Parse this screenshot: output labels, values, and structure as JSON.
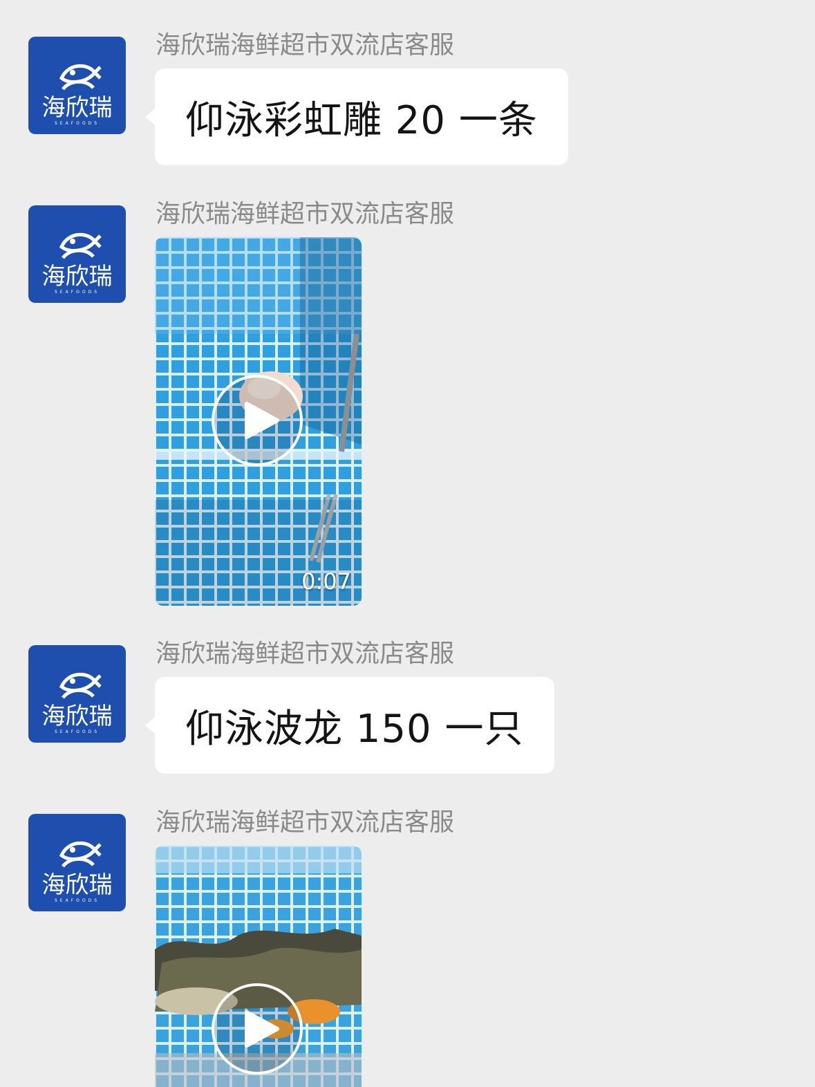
{
  "colors": {
    "background": "#ededed",
    "avatar": "#1f4fae",
    "bubble": "#ffffff",
    "sender_text": "#8a8a8a"
  },
  "avatar": {
    "icon": "fish-logo-icon",
    "brand": "海欣瑞",
    "tagline": "SEAFOODS"
  },
  "messages": [
    {
      "type": "text",
      "sender": "海欣瑞海鲜超市双流店客服",
      "text": "仰泳彩虹雕 20 一条"
    },
    {
      "type": "video",
      "sender": "海欣瑞海鲜超市双流店客服",
      "duration": "0:07",
      "icon": "play-icon"
    },
    {
      "type": "text",
      "sender": "海欣瑞海鲜超市双流店客服",
      "text": "仰泳波龙 150 一只"
    },
    {
      "type": "video",
      "sender": "海欣瑞海鲜超市双流店客服",
      "icon": "play-icon"
    }
  ]
}
